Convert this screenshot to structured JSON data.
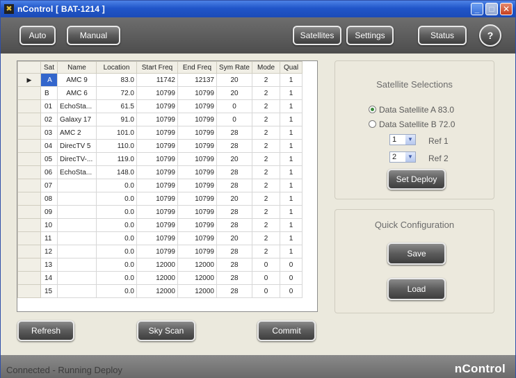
{
  "window": {
    "title": "nControl   [ BAT-1214 ]"
  },
  "toolbar": {
    "auto": "Auto",
    "manual": "Manual",
    "satellites": "Satellites",
    "settings": "Settings",
    "status": "Status",
    "help": "?"
  },
  "grid": {
    "columns": [
      "Sat",
      "Name",
      "Location",
      "Start Freq",
      "End Freq",
      "Sym Rate",
      "Mode",
      "Qual"
    ],
    "rows": [
      [
        "A",
        "AMC 9",
        "83.0",
        "11742",
        "12137",
        "20",
        "2",
        "1"
      ],
      [
        "B",
        "AMC 6",
        "72.0",
        "10799",
        "10799",
        "20",
        "2",
        "1"
      ],
      [
        "01",
        "EchoSta...",
        "61.5",
        "10799",
        "10799",
        "0",
        "2",
        "1"
      ],
      [
        "02",
        "Galaxy 17",
        "91.0",
        "10799",
        "10799",
        "0",
        "2",
        "1"
      ],
      [
        "03",
        "AMC 2",
        "101.0",
        "10799",
        "10799",
        "28",
        "2",
        "1"
      ],
      [
        "04",
        "DirecTV 5",
        "110.0",
        "10799",
        "10799",
        "28",
        "2",
        "1"
      ],
      [
        "05",
        "DirecTV-...",
        "119.0",
        "10799",
        "10799",
        "20",
        "2",
        "1"
      ],
      [
        "06",
        "EchoSta...",
        "148.0",
        "10799",
        "10799",
        "28",
        "2",
        "1"
      ],
      [
        "07",
        "",
        "0.0",
        "10799",
        "10799",
        "28",
        "2",
        "1"
      ],
      [
        "08",
        "",
        "0.0",
        "10799",
        "10799",
        "20",
        "2",
        "1"
      ],
      [
        "09",
        "",
        "0.0",
        "10799",
        "10799",
        "28",
        "2",
        "1"
      ],
      [
        "10",
        "",
        "0.0",
        "10799",
        "10799",
        "28",
        "2",
        "1"
      ],
      [
        "11",
        "",
        "0.0",
        "10799",
        "10799",
        "20",
        "2",
        "1"
      ],
      [
        "12",
        "",
        "0.0",
        "10799",
        "10799",
        "28",
        "2",
        "1"
      ],
      [
        "13",
        "",
        "0.0",
        "12000",
        "12000",
        "28",
        "0",
        "0"
      ],
      [
        "14",
        "",
        "0.0",
        "12000",
        "12000",
        "28",
        "0",
        "0"
      ],
      [
        "15",
        "",
        "0.0",
        "12000",
        "12000",
        "28",
        "0",
        "0"
      ]
    ],
    "current_row_marker": "▶"
  },
  "satellite_selections": {
    "title": "Satellite Selections",
    "option_a": "Data Satellite A 83.0",
    "option_b": "Data Satellite B 72.0",
    "ref1_value": "1",
    "ref1_label": "Ref 1",
    "ref2_value": "2",
    "ref2_label": "Ref 2",
    "set_deploy": "Set Deploy"
  },
  "quick_config": {
    "title": "Quick Configuration",
    "save": "Save",
    "load": "Load"
  },
  "bottom_buttons": {
    "refresh": "Refresh",
    "sky_scan": "Sky Scan",
    "commit": "Commit"
  },
  "statusbar": {
    "text": "Connected - Running  Deploy",
    "brand": "nControl"
  },
  "colors": {
    "titlebar": "#2156c9",
    "toolbar": "#5b5b5b",
    "selected_cell": "#3366cc",
    "panel_bg": "#ece9dd"
  }
}
